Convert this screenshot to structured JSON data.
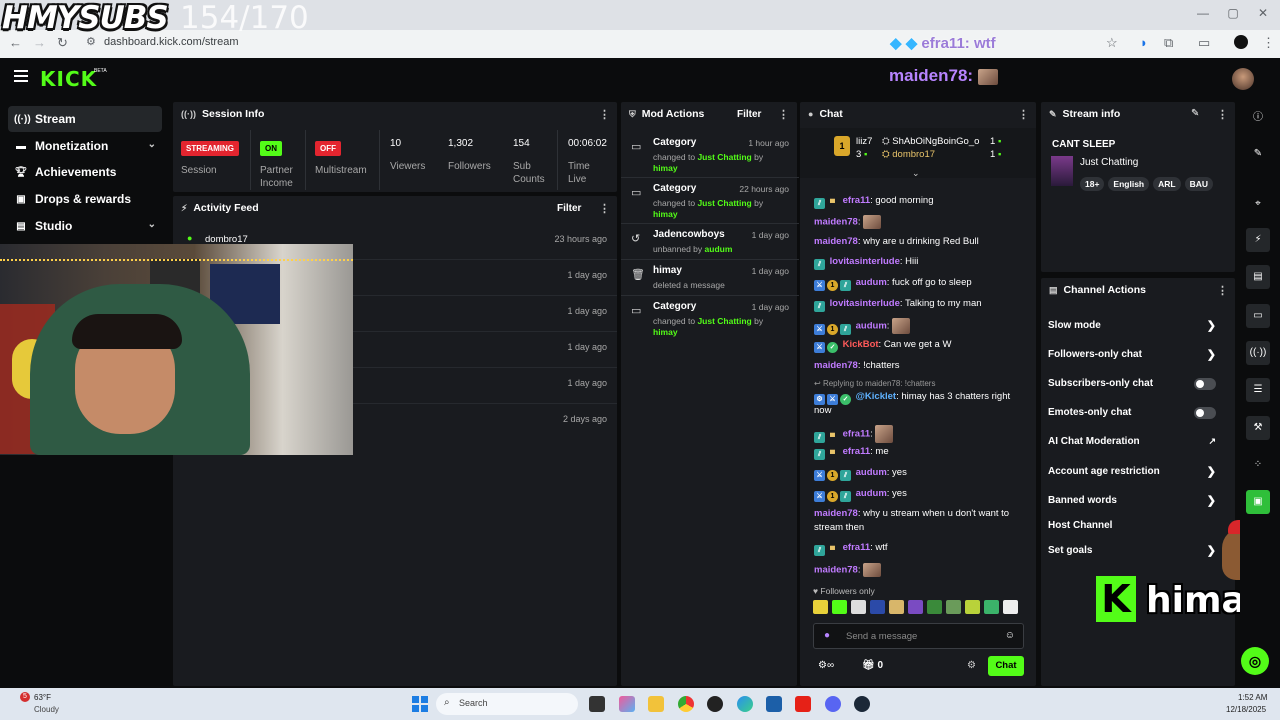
{
  "browser": {
    "url": "dashboard.kick.com/stream",
    "overlay_subs": "HMYSUBS",
    "overlay_count": "154/170",
    "overlay_alert": "efra11: wtf"
  },
  "topbar": {
    "logo": "KICK",
    "logo_badge": "BETA",
    "alert": "maiden78:"
  },
  "nav": {
    "items": [
      {
        "label": "Stream",
        "icon": "stream-icon"
      },
      {
        "label": "Monetization",
        "icon": "monetization-icon"
      },
      {
        "label": "Achievements",
        "icon": "trophy-icon"
      },
      {
        "label": "Drops & rewards",
        "icon": "gift-icon"
      },
      {
        "label": "Studio",
        "icon": "studio-icon"
      }
    ]
  },
  "session": {
    "title": "Session Info",
    "status_badge": "STREAMING",
    "status_label": "Session",
    "partner_badge": "ON",
    "partner_label": "Partner Income",
    "multi_badge": "OFF",
    "multi_label": "Multistream",
    "viewers": "10",
    "viewers_label": "Viewers",
    "followers": "1,302",
    "followers_label": "Followers",
    "subs": "154",
    "subs_label": "Sub Counts",
    "time": "00:06:02",
    "time_label": "Time Live"
  },
  "activity": {
    "title": "Activity Feed",
    "filter": "Filter",
    "rows": [
      {
        "user": "dombro17",
        "time": "23 hours ago"
      },
      {
        "user": "",
        "time": "1 day ago"
      },
      {
        "user": "",
        "time": "1 day ago"
      },
      {
        "user": "",
        "time": "1 day ago"
      },
      {
        "user": "",
        "time": "1 day ago"
      },
      {
        "user": "",
        "time": "2 days ago"
      }
    ]
  },
  "mod": {
    "title": "Mod Actions",
    "filter": "Filter",
    "rows": [
      {
        "title": "Category",
        "time": "1 hour ago",
        "pre": "changed to ",
        "hl": "Just Chatting",
        "post": " by ",
        "by": "himay"
      },
      {
        "title": "Category",
        "time": "22 hours ago",
        "pre": "changed to ",
        "hl": "Just Chatting",
        "post": " by ",
        "by": "himay"
      },
      {
        "title": "Jadencowboys",
        "time": "1 day ago",
        "pre": "unbanned by ",
        "hl": "",
        "post": "",
        "by": "audum"
      },
      {
        "title": "himay",
        "time": "1 day ago",
        "pre": "deleted a message",
        "hl": "",
        "post": "",
        "by": ""
      },
      {
        "title": "Category",
        "time": "1 day ago",
        "pre": "changed to ",
        "hl": "Just Chatting",
        "post": " by ",
        "by": "himay"
      }
    ]
  },
  "chat": {
    "title": "Chat",
    "leaders": [
      {
        "name": "liiz7",
        "count": "3"
      },
      {
        "name": "ShAbOiNgBoinGo_o",
        "count": "1"
      },
      {
        "name": "dombro17",
        "count": "1"
      }
    ],
    "rank": "1",
    "messages": {
      "m1_user": "efra11",
      "m1_text": ": good morning",
      "m2_user": "maiden78",
      "m2_text": ":",
      "m3_user": "maiden78",
      "m3_text": ": why are u drinking Red Bull",
      "m4_user": "lovitasinterlude",
      "m4_text": ": Hiii",
      "m5_user": "audum",
      "m5_text": ": fuck off go to sleep",
      "m6_user": "lovitasinterlude",
      "m6_text": ": Talking to my man",
      "m7_user": "audum",
      "m7_text": ":",
      "m8_user": "KickBot",
      "m8_text": ": Can we get a W",
      "m9_user": "maiden78",
      "m9_text": ": !chatters",
      "reply": "Replying to maiden78: !chatters",
      "m10_user": "@Kicklet",
      "m10_text": ": himay has 3 chatters right",
      "m10_text2": "now",
      "m11_user": "efra11",
      "m11_text": ":",
      "m12_user": "efra11",
      "m12_text": ": me",
      "m13_user": "audum",
      "m13_text": ": yes",
      "m14_user": "audum",
      "m14_text": ": yes",
      "m15_user": "maiden78",
      "m15_text": ": why u stream when u don't want to",
      "m15_text2": "stream then",
      "m16_user": "efra11",
      "m16_text": ": wtf",
      "m17_user": "maiden78",
      "m17_text": ":"
    },
    "followers_only": "Followers only",
    "placeholder": "Send a message",
    "count": "0",
    "send": "Chat"
  },
  "stream_info": {
    "title": "Stream info",
    "stream_title": "CANT SLEEP",
    "category": "Just Chatting",
    "tags": [
      "18+",
      "English",
      "ARL",
      "BAU"
    ]
  },
  "channel_actions": {
    "title": "Channel Actions",
    "items": [
      "Slow mode",
      "Followers-only chat",
      "Subscribers-only chat",
      "Emotes-only chat",
      "AI Chat Moderation",
      "Account age restriction",
      "Banned words",
      "Host Channel",
      "Set goals"
    ]
  },
  "overlay_logo": "himay",
  "taskbar": {
    "temp": "63°F",
    "weather": "Cloudy",
    "search": "Search",
    "time": "1:52 AM",
    "date": "12/18/2025",
    "weather_badge": "5"
  },
  "colors": {
    "kick_green": "#53fc18",
    "panel": "#191b1f",
    "bg": "#0b0c0d"
  }
}
